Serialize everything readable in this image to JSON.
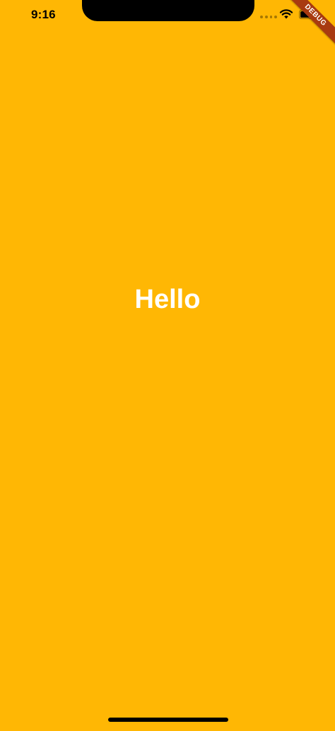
{
  "status_bar": {
    "time": "9:16",
    "wifi_icon": "wifi-icon",
    "battery_icon": "battery-icon"
  },
  "debug_banner": {
    "label": "DEBUG",
    "color": "#A83A10"
  },
  "main": {
    "text": "Hello",
    "text_color": "#FFFFFF",
    "background_color": "#FFB704"
  }
}
